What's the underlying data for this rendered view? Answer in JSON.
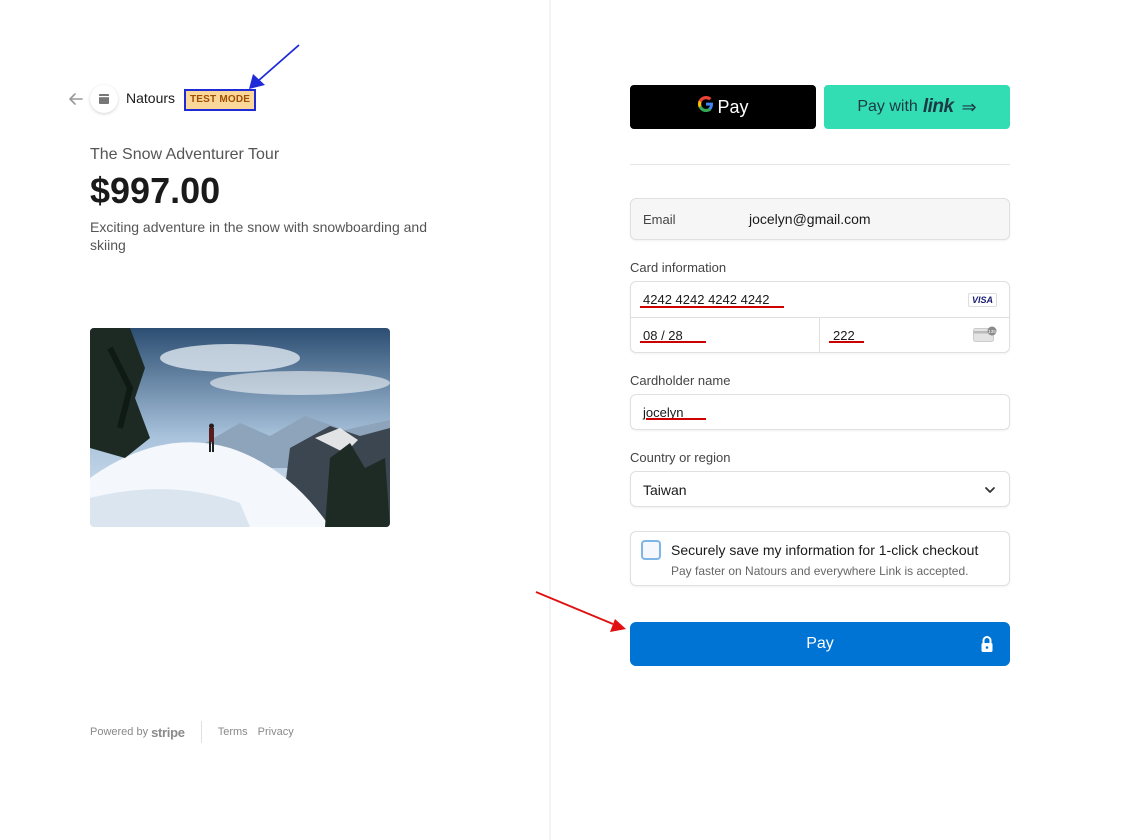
{
  "merchant": {
    "name": "Natours",
    "badge": "TEST MODE"
  },
  "product": {
    "name": "The Snow Adventurer Tour",
    "price": "$997.00",
    "description": "Exciting adventure in the snow with snowboarding and skiing"
  },
  "footer": {
    "powered_by": "Powered by",
    "brand": "stripe",
    "terms": "Terms",
    "privacy": "Privacy"
  },
  "wallets": {
    "gpay_label": "Pay",
    "link_prefix": "Pay with",
    "link_brand": "link"
  },
  "email": {
    "label": "Email",
    "value": "jocelyn@gmail.com"
  },
  "card": {
    "label": "Card information",
    "number": "4242 4242 4242 4242",
    "brand": "VISA",
    "expiry": "08 / 28",
    "cvc": "222"
  },
  "cardholder": {
    "label": "Cardholder name",
    "value": "jocelyn"
  },
  "country": {
    "label": "Country or region",
    "value": "Taiwan"
  },
  "save_info": {
    "title": "Securely save my information for 1-click checkout",
    "subtitle": "Pay faster on Natours and everywhere Link is accepted."
  },
  "pay_button": {
    "label": "Pay"
  },
  "colors": {
    "pay_blue": "#0074d4",
    "link_green": "#33ddb3",
    "badge_bg": "#fcd79a",
    "annotation_blue": "#1f2bd6",
    "annotation_red": "#e01010"
  }
}
